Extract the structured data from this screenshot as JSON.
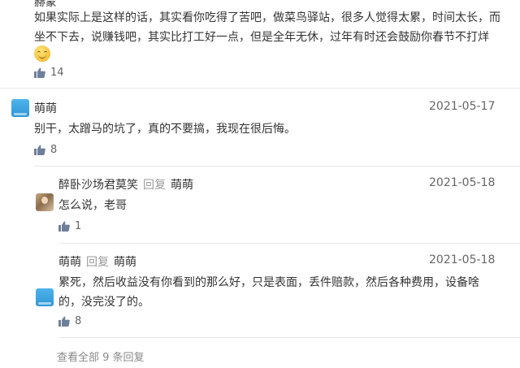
{
  "comments": [
    {
      "name": "赫蒙",
      "text_lines": [
        "如果实际上是这样的话，其实看你吃得了苦吧，做菜鸟驿站，很多人觉得太累，时间太长，而",
        "坐不下去，说赚钱吧，其实比打工好一点，但是全年无休，过年有时还会鼓励你春节不打烊"
      ],
      "emoji": "grinning-face",
      "likes": "14"
    },
    {
      "name": "萌萌",
      "date": "2021-05-17",
      "text": "别干，太蹭马的坑了，真的不要搞，我现在很后悔。",
      "likes": "8",
      "replies": [
        {
          "name": "醉卧沙场君莫笑",
          "reply_label": "回复",
          "reply_to": "萌萌",
          "date": "2021-05-18",
          "text": "怎么说，老哥",
          "likes": "1"
        },
        {
          "name": "萌萌",
          "reply_label": "回复",
          "reply_to": "萌萌",
          "date": "2021-05-18",
          "text_lines": [
            "累死，然后收益没有你看到的那么好，只是表面，丢件赔款，然后各种费用，设备啥",
            "的，没完没了的。"
          ],
          "likes": "8"
        }
      ],
      "view_all": "查看全部 9 条回复"
    }
  ],
  "colors": {
    "text": "#333333",
    "muted": "#999999",
    "date": "#666666",
    "divider": "#e8e8e8",
    "avatar_blue": "#3aa4e0"
  },
  "icons": {
    "like": "thumbs-up-icon"
  }
}
